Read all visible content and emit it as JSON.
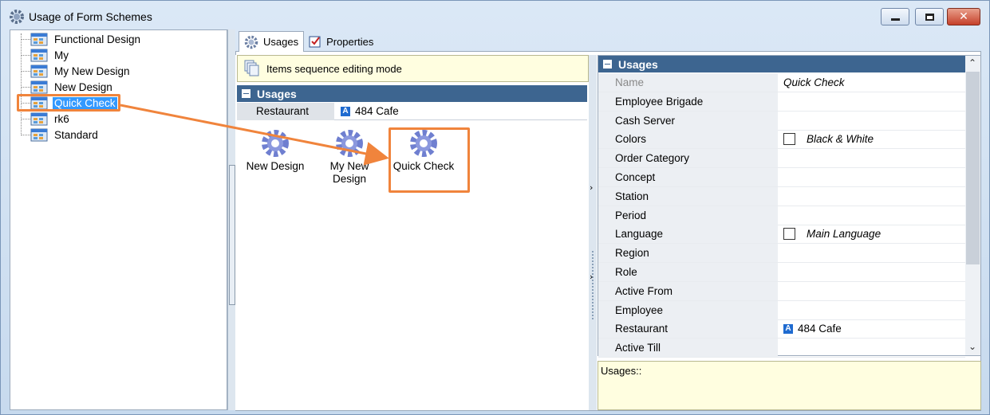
{
  "window": {
    "title": "Usage of Form Schemes",
    "controls": {
      "minimize_icon": "minimize-icon",
      "maximize_icon": "restore-icon",
      "close_icon": "close-icon"
    }
  },
  "tree": {
    "items": [
      {
        "label": "Functional Design",
        "icon": "form-scheme-icon"
      },
      {
        "label": "My",
        "icon": "form-scheme-icon"
      },
      {
        "label": "My New Design",
        "icon": "form-scheme-icon"
      },
      {
        "label": "New Design",
        "icon": "form-scheme-icon"
      },
      {
        "label": "Quick Check",
        "icon": "form-scheme-icon",
        "selected": true
      },
      {
        "label": "rk6",
        "icon": "form-scheme-icon"
      },
      {
        "label": "Standard",
        "icon": "form-scheme-icon"
      }
    ]
  },
  "tabs": [
    {
      "label": "Usages",
      "icon": "gear-icon",
      "active": true
    },
    {
      "label": "Properties",
      "icon": "properties-icon",
      "active": false
    }
  ],
  "usages_panel": {
    "notice": "Items sequence editing mode",
    "group_title": "Usages",
    "filter": {
      "key": "Restaurant",
      "value": "484 Cafe",
      "badge": "A"
    },
    "items": [
      {
        "label_line1": "New Design",
        "label_line2": ""
      },
      {
        "label_line1": "My New",
        "label_line2": "Design"
      },
      {
        "label_line1": "Quick Check",
        "label_line2": ""
      }
    ]
  },
  "properties": {
    "group_title": "Usages",
    "rows": [
      {
        "key": "Name",
        "value": "Quick Check",
        "dim": true
      },
      {
        "key": "Employee Brigade",
        "value": ""
      },
      {
        "key": "Cash Server",
        "value": ""
      },
      {
        "key": "Colors",
        "value": "Black & White",
        "checkbox": true
      },
      {
        "key": "Order Category",
        "value": ""
      },
      {
        "key": "Concept",
        "value": ""
      },
      {
        "key": "Station",
        "value": ""
      },
      {
        "key": "Period",
        "value": ""
      },
      {
        "key": "Language",
        "value": "Main Language",
        "checkbox": true
      },
      {
        "key": "Region",
        "value": ""
      },
      {
        "key": "Role",
        "value": ""
      },
      {
        "key": "Active From",
        "value": ""
      },
      {
        "key": "Employee",
        "value": ""
      },
      {
        "key": "Restaurant",
        "value": "484 Cafe",
        "badge": "A"
      },
      {
        "key": "Active Till",
        "value": ""
      }
    ],
    "description": "Usages::"
  },
  "colors": {
    "accent_header": "#3d6590",
    "highlight_annotation": "#f0843c",
    "selection": "#3399ff",
    "notice_bg": "#fffee0"
  }
}
